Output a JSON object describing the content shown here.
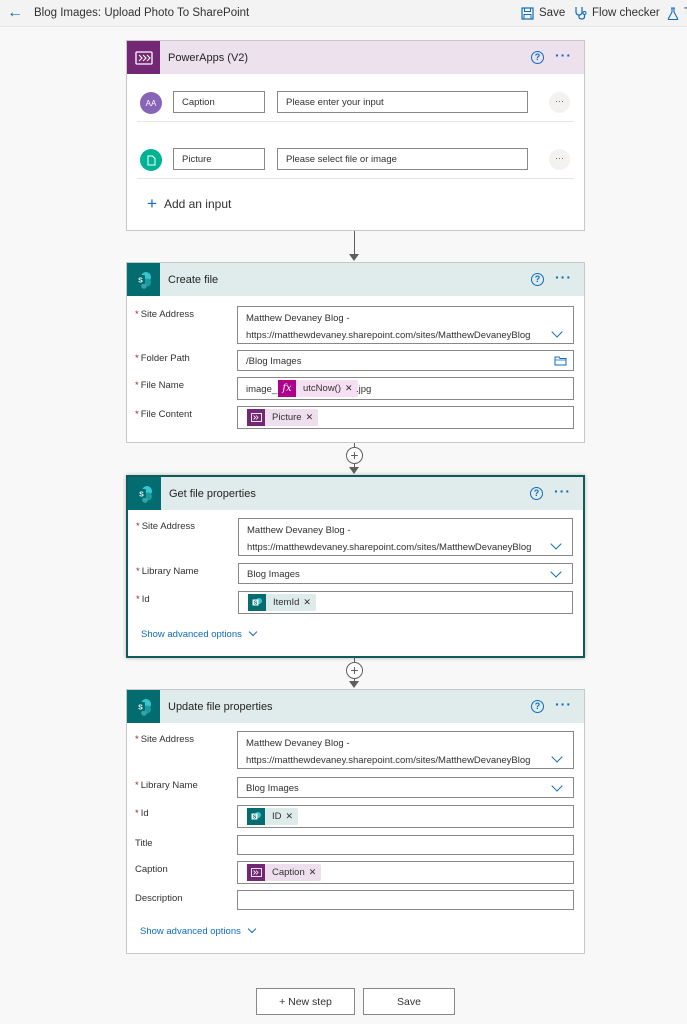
{
  "topbar": {
    "title": "Blog Images: Upload Photo To SharePoint",
    "save_label": "Save",
    "flow_checker_label": "Flow checker",
    "test_label": "T"
  },
  "trigger": {
    "title": "PowerApps (V2)",
    "inputs": [
      {
        "name": "Caption",
        "placeholder": "Please enter your input",
        "icon": "text-input-icon",
        "icon_text": "AA",
        "color": "#8764b8"
      },
      {
        "name": "Picture",
        "placeholder": "Please select file or image",
        "icon": "file-input-icon",
        "color": "#00b294"
      }
    ],
    "add_input_label": "Add an input"
  },
  "create_file": {
    "title": "Create file",
    "site_address_label": "Site Address",
    "site_address_line1": "Matthew Devaney Blog -",
    "site_address_line2": "https://matthewdevaney.sharepoint.com/sites/MatthewDevaneyBlog",
    "folder_path_label": "Folder Path",
    "folder_path_value": "/Blog Images",
    "file_name_label": "File Name",
    "file_name_prefix": "image_",
    "file_name_token": "utcNow()",
    "file_name_suffix": ".jpg",
    "file_content_label": "File Content",
    "file_content_token": "Picture"
  },
  "get_props": {
    "title": "Get file properties",
    "site_address_label": "Site Address",
    "site_address_line1": "Matthew Devaney Blog -",
    "site_address_line2": "https://matthewdevaney.sharepoint.com/sites/MatthewDevaneyBlog",
    "library_label": "Library Name",
    "library_value": "Blog Images",
    "id_label": "Id",
    "id_token": "ItemId",
    "advanced_label": "Show advanced options"
  },
  "update_props": {
    "title": "Update file properties",
    "site_address_label": "Site Address",
    "site_address_line1": "Matthew Devaney Blog -",
    "site_address_line2": "https://matthewdevaney.sharepoint.com/sites/MatthewDevaneyBlog",
    "library_label": "Library Name",
    "library_value": "Blog Images",
    "id_label": "Id",
    "id_token": "ID",
    "title_label": "Title",
    "caption_label": "Caption",
    "caption_token": "Caption",
    "description_label": "Description",
    "advanced_label": "Show advanced options"
  },
  "footer": {
    "new_step_label": "+ New step",
    "save_label": "Save"
  },
  "colors": {
    "accent": "#0f6cbd",
    "powerapps": "#742774",
    "sharepoint": "#036c70",
    "expression": "#ad008c"
  }
}
